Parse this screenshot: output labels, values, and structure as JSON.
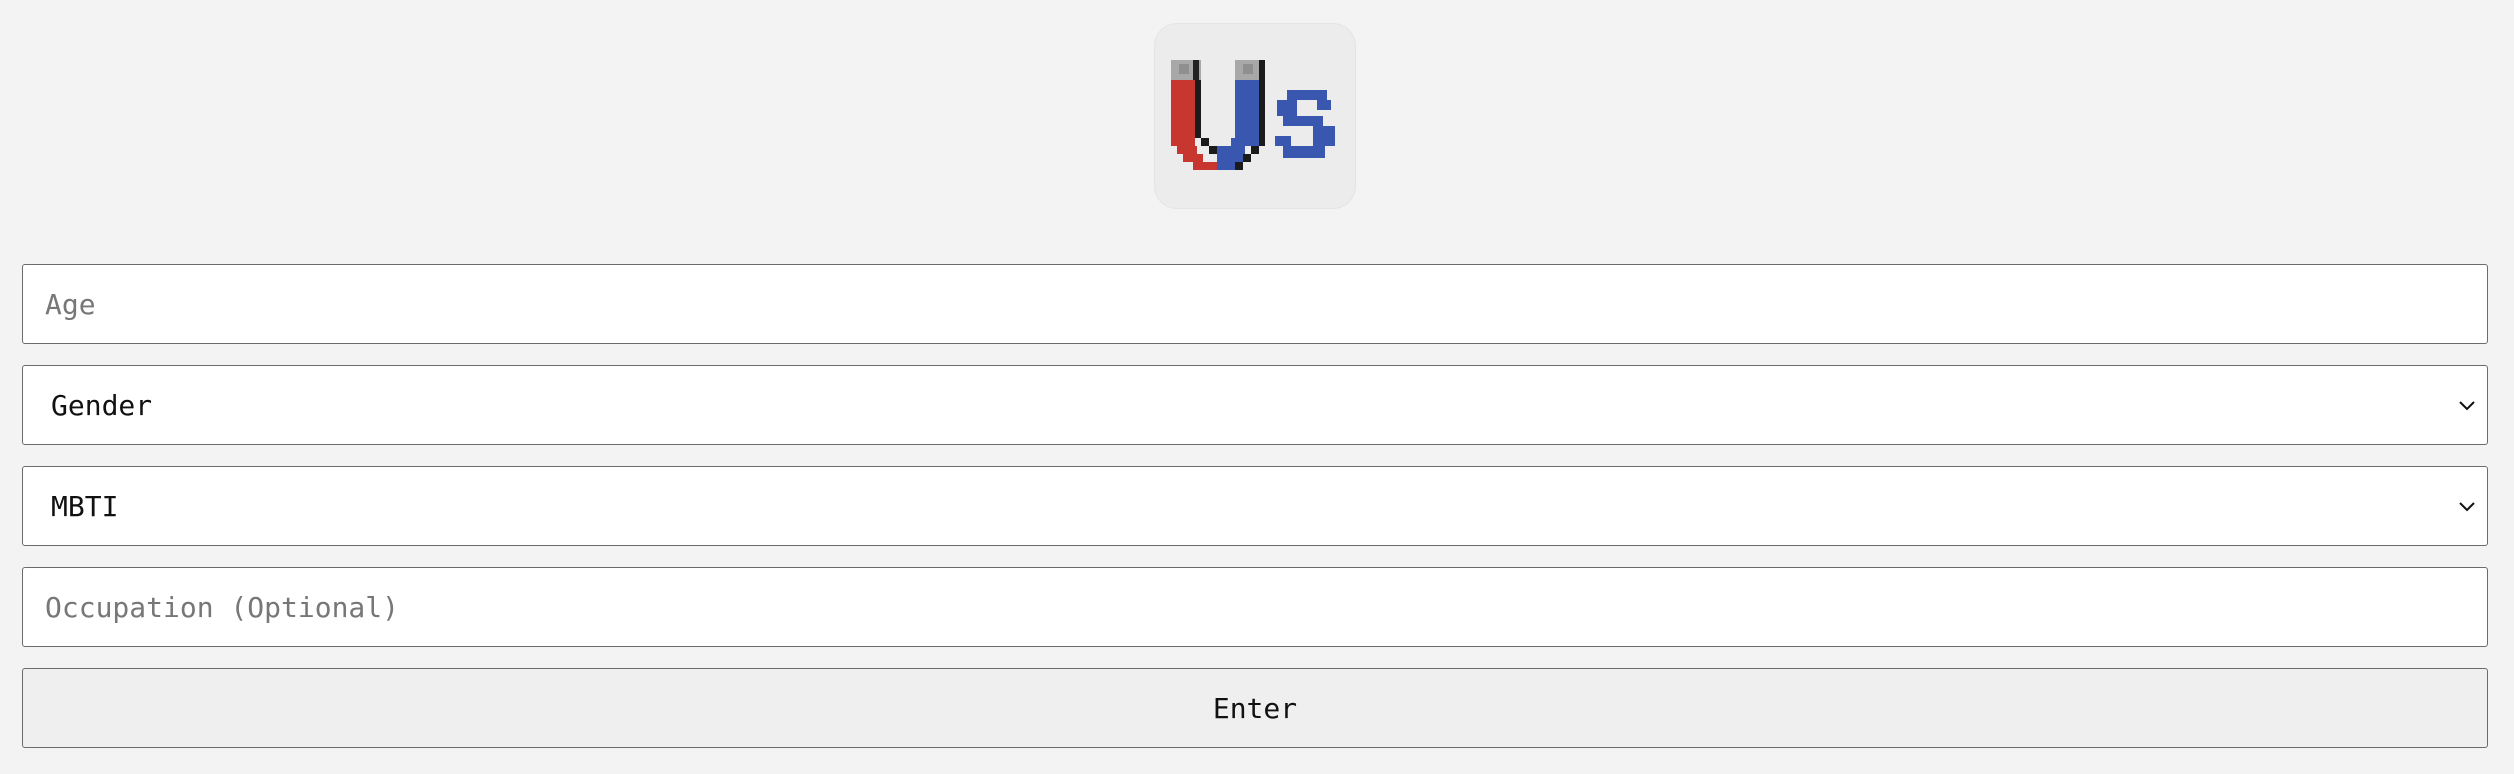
{
  "logo": {
    "icon": "magnet-us-logo",
    "colors": {
      "red": "#c8372f",
      "blue": "#3a57b0",
      "tip": "#a8a8a8",
      "outline": "#1b1b1b"
    }
  },
  "form": {
    "age_placeholder": "Age",
    "gender_selected": "Gender",
    "mbti_selected": "MBTI",
    "occupation_placeholder": "Occupation (Optional)",
    "enter_label": "Enter"
  }
}
